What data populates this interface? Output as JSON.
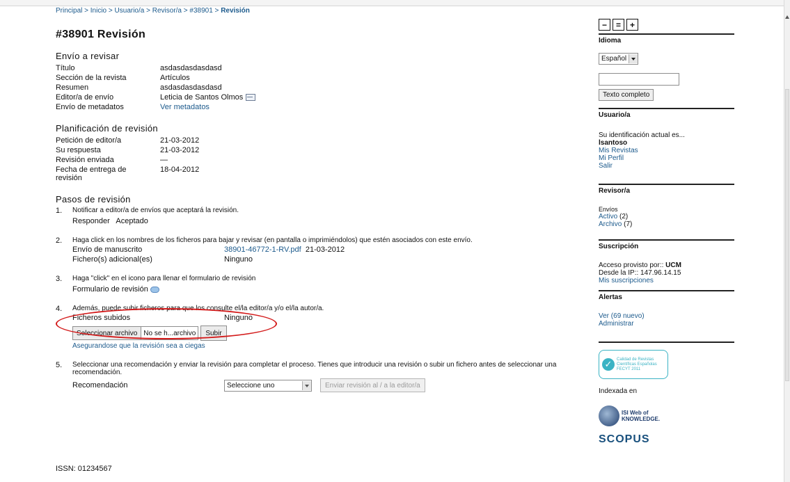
{
  "breadcrumb": {
    "items": [
      "Principal",
      "Inicio",
      "Usuario/a",
      "Revisor/a",
      "#38901"
    ],
    "separator": " > ",
    "current": "Revisión"
  },
  "page_title": "#38901 Revisión",
  "envio": {
    "heading": "Envío a revisar",
    "rows": [
      {
        "label": "Título",
        "value": "asdasdasdasdasd"
      },
      {
        "label": "Sección de la revista",
        "value": "Artículos"
      },
      {
        "label": "Resumen",
        "value": "asdasdasdasdasd"
      },
      {
        "label": "Editor/a de envío",
        "value": "Leticia de Santos Olmos"
      },
      {
        "label": "Envío de metadatos",
        "value": "Ver metadatos"
      }
    ]
  },
  "planificacion": {
    "heading": "Planificación de revisión",
    "rows": [
      {
        "label": "Petición de editor/a",
        "value": "21-03-2012"
      },
      {
        "label": "Su respuesta",
        "value": "21-03-2012"
      },
      {
        "label": "Revisión enviada",
        "value": "—"
      },
      {
        "label": "Fecha de entrega de revisión",
        "value": "18-04-2012"
      }
    ]
  },
  "pasos": {
    "heading": "Pasos de revisión",
    "step1": {
      "num": "1.",
      "text": "Notificar a editor/a de envíos que aceptará la revisión.",
      "sub_label": "Responder",
      "sub_value": "Aceptado"
    },
    "step2": {
      "num": "2.",
      "text": "Haga click en los nombres de los ficheros para bajar y revisar (en pantalla o imprimiéndolos) que estén asociados con este envío.",
      "row1_label": "Envío de manuscrito",
      "row1_file": "38901-46772-1-RV.pdf",
      "row1_date": "21-03-2012",
      "row2_label": "Fichero(s) adicional(es)",
      "row2_value": "Ninguno"
    },
    "step3": {
      "num": "3.",
      "text": "Haga \"click\" en el icono para llenar el formulario de revisión",
      "sub_label": "Formulario de revisión"
    },
    "step4": {
      "num": "4.",
      "text": "Además, puede subir ficheros para que los consulte el/la editor/a y/o el/la autor/a.",
      "row_label": "Ficheros subidos",
      "row_value": "Ninguno",
      "choose_file": "Seleccionar archivo",
      "no_file": "No se h...archivo",
      "upload": "Subir",
      "blind_link": "Asegurandose que la revisión sea a ciegas"
    },
    "step5": {
      "num": "5.",
      "text": "Seleccionar una recomendación y enviar la revisión para completar el proceso. Tienes que introducir una revisión o subir un fichero antes de seleccionar una recomendación.",
      "row_label": "Recomendación",
      "select_value": "Seleccione uno",
      "send_button": "Enviar revisión al / a la editor/a"
    }
  },
  "issn": "ISSN: 01234567",
  "sidebar": {
    "font_buttons": [
      "−",
      "=",
      "+"
    ],
    "idioma": {
      "title": "Idioma",
      "selected": "Español",
      "search_button": "Texto completo"
    },
    "usuario": {
      "title": "Usuario/a",
      "text": "Su identificación actual es...",
      "username": "lsantoso",
      "links": [
        "Mis Revistas",
        "Mi Perfil",
        "Salir"
      ]
    },
    "revisor": {
      "title": "Revisor/a",
      "label": "Envíos",
      "activo_link": "Activo",
      "activo_count": "(2)",
      "archivo_link": "Archivo",
      "archivo_count": "(7)"
    },
    "suscripcion": {
      "title": "Suscripción",
      "line1_prefix": "Acceso provisto por::",
      "line1_org": "UCM",
      "line2": "Desde la IP:: 147.96.14.15",
      "link": "Mis suscripciones"
    },
    "alertas": {
      "title": "Alertas",
      "ver": "Ver",
      "ver_count": "(69 nuevo)",
      "admin": "Administrar"
    },
    "calidad_logo": {
      "line1": "Calidad de Revistas",
      "line2": "Científicas Españolas",
      "line3": "FECYT",
      "year": "2011"
    },
    "indexada": "Indexada en",
    "isi_logo": {
      "line1": "ISI",
      "line2": "Web of",
      "line3": "KNOWLEDGE."
    },
    "scopus": "SCOPUS"
  }
}
